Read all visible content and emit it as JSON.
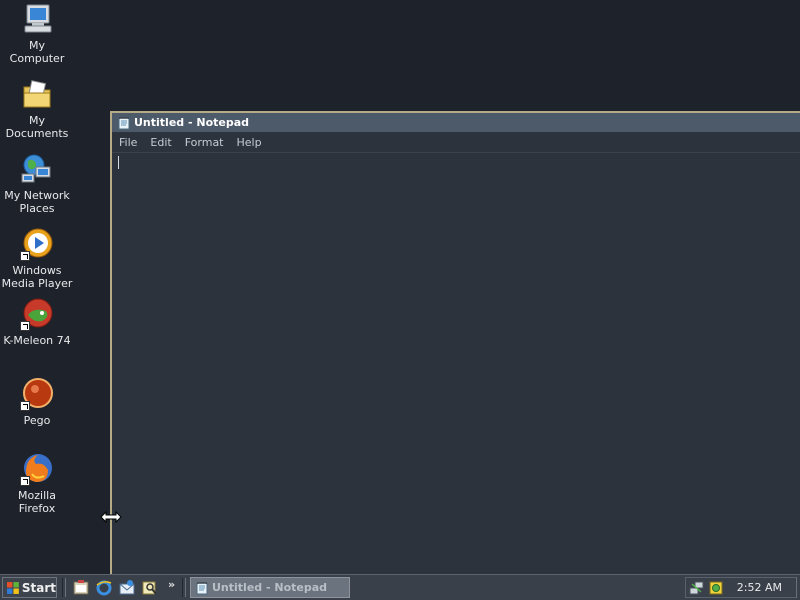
{
  "desktop": {
    "icons": [
      {
        "label": "My Computer",
        "icon": "my-computer-icon"
      },
      {
        "label": "My Documents",
        "icon": "my-documents-icon"
      },
      {
        "label": "My Network Places",
        "icon": "network-places-icon"
      },
      {
        "label": "Windows Media Player",
        "icon": "media-player-icon"
      },
      {
        "label": "K-Meleon 74",
        "icon": "k-meleon-icon"
      },
      {
        "label": "Pego",
        "icon": "pego-icon"
      },
      {
        "label": "Mozilla Firefox",
        "icon": "firefox-icon"
      }
    ]
  },
  "window": {
    "title": "Untitled - Notepad",
    "menu": [
      "File",
      "Edit",
      "Format",
      "Help"
    ],
    "content": ""
  },
  "taskbar": {
    "start_label": "Start",
    "quick_launch": [
      "show-desktop-icon",
      "internet-explorer-icon",
      "outlook-express-icon",
      "search-icon"
    ],
    "overflow": "»",
    "task_label": "Untitled - Notepad",
    "clock": "2:52 AM"
  },
  "colors": {
    "desktop": "#1e232b",
    "window_border": "#b5ab84",
    "titlebar": "#4d5a6a",
    "taskbar": "#3a4049"
  }
}
